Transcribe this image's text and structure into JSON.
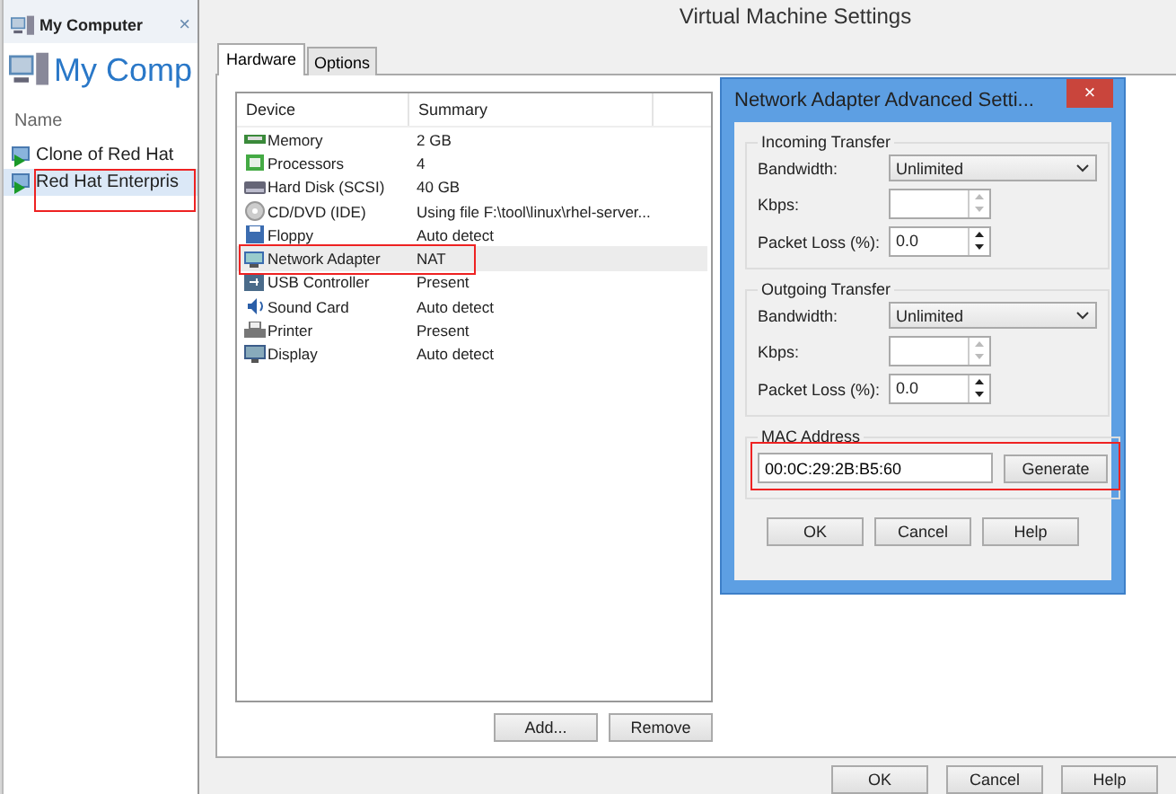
{
  "left_panel": {
    "tab": {
      "label": "My Computer",
      "close": "×"
    },
    "heading": "My Comp",
    "column": "Name",
    "items": [
      {
        "label": "Clone of Red Hat",
        "selected": false,
        "highlighted": false
      },
      {
        "label": "Red Hat Enterpris",
        "selected": true,
        "highlighted": true
      }
    ]
  },
  "window": {
    "title": "Virtual Machine Settings"
  },
  "tabs": [
    {
      "label": "Hardware",
      "selected": true
    },
    {
      "label": "Options",
      "selected": false
    }
  ],
  "devices": {
    "columns": [
      "Device",
      "Summary"
    ],
    "rows": [
      {
        "device": "Memory",
        "summary": "2 GB",
        "selected": false,
        "highlighted": false
      },
      {
        "device": "Processors",
        "summary": "4",
        "selected": false,
        "highlighted": false
      },
      {
        "device": "Hard Disk (SCSI)",
        "summary": "40 GB",
        "selected": false,
        "highlighted": false
      },
      {
        "device": "CD/DVD (IDE)",
        "summary": "Using file F:\\tool\\linux\\rhel-server...",
        "selected": false,
        "highlighted": false
      },
      {
        "device": "Floppy",
        "summary": "Auto detect",
        "selected": false,
        "highlighted": false
      },
      {
        "device": "Network Adapter",
        "summary": "NAT",
        "selected": true,
        "highlighted": true
      },
      {
        "device": "USB Controller",
        "summary": "Present",
        "selected": false,
        "highlighted": false
      },
      {
        "device": "Sound Card",
        "summary": "Auto detect",
        "selected": false,
        "highlighted": false
      },
      {
        "device": "Printer",
        "summary": "Present",
        "selected": false,
        "highlighted": false
      },
      {
        "device": "Display",
        "summary": "Auto detect",
        "selected": false,
        "highlighted": false
      }
    ]
  },
  "device_buttons": [
    "Add...",
    "Remove"
  ],
  "dialog": {
    "title": "Network Adapter Advanced Setti...",
    "close": "×",
    "groups": [
      {
        "title": "Incoming Transfer",
        "bandwidth_label": "Bandwidth:",
        "bandwidth": "Unlimited",
        "kbps_label": "Kbps:",
        "kbps_disabled": true,
        "loss_label": "Packet Loss (%):",
        "loss": "0.0"
      },
      {
        "title": "Outgoing Transfer",
        "bandwidth_label": "Bandwidth:",
        "bandwidth": "Unlimited",
        "kbps_label": "Kbps:",
        "kbps_disabled": true,
        "loss_label": "Packet Loss (%):",
        "loss": "0.0"
      }
    ],
    "mac": {
      "title": "MAC Address",
      "value": "00:0C:29:2B:B5:60",
      "button": "Generate",
      "highlighted": true
    },
    "buttons": [
      "OK",
      "Cancel",
      "Help"
    ]
  },
  "buttons": [
    "OK",
    "Cancel",
    "Help"
  ]
}
